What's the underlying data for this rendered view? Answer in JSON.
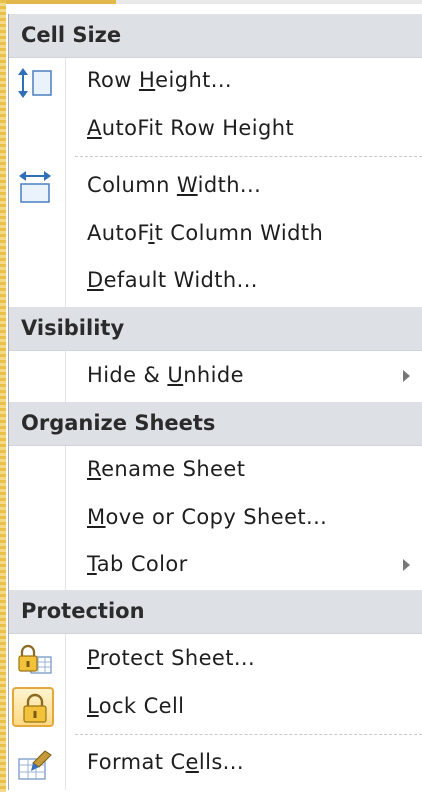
{
  "menu": {
    "sections": {
      "cell_size": "Cell Size",
      "visibility": "Visibility",
      "organize": "Organize Sheets",
      "protection": "Protection"
    },
    "items": {
      "row_height": {
        "pre": "Row ",
        "key": "H",
        "post": "eight..."
      },
      "autofit_row": {
        "pre": "",
        "key": "A",
        "post": "utoFit Row Height"
      },
      "column_width": {
        "pre": "Column ",
        "key": "W",
        "post": "idth..."
      },
      "autofit_column": {
        "pre": "AutoF",
        "key": "i",
        "post": "t Column Width"
      },
      "default_width": {
        "pre": "",
        "key": "D",
        "post": "efault Width..."
      },
      "hide_unhide": {
        "pre": "Hide & ",
        "key": "U",
        "post": "nhide"
      },
      "rename_sheet": {
        "pre": "",
        "key": "R",
        "post": "ename Sheet"
      },
      "move_copy": {
        "pre": "",
        "key": "M",
        "post": "ove or Copy Sheet..."
      },
      "tab_color": {
        "pre": "",
        "key": "T",
        "post": "ab Color"
      },
      "protect_sheet": {
        "pre": "",
        "key": "P",
        "post": "rotect Sheet..."
      },
      "lock_cell": {
        "pre": "",
        "key": "L",
        "post": "ock Cell"
      },
      "format_cells": {
        "pre": "Format C",
        "key": "e",
        "post": "lls..."
      }
    },
    "icons": {
      "row_height": "row-height-icon",
      "column_width": "column-width-icon",
      "protect_sheet": "protect-sheet-icon",
      "lock_cell": "lock-cell-icon",
      "format_cells": "format-cells-icon"
    },
    "colors": {
      "section_bg": "#dde1e6",
      "lock_highlight": "#ffd983",
      "lock_border": "#e3a73c"
    }
  }
}
